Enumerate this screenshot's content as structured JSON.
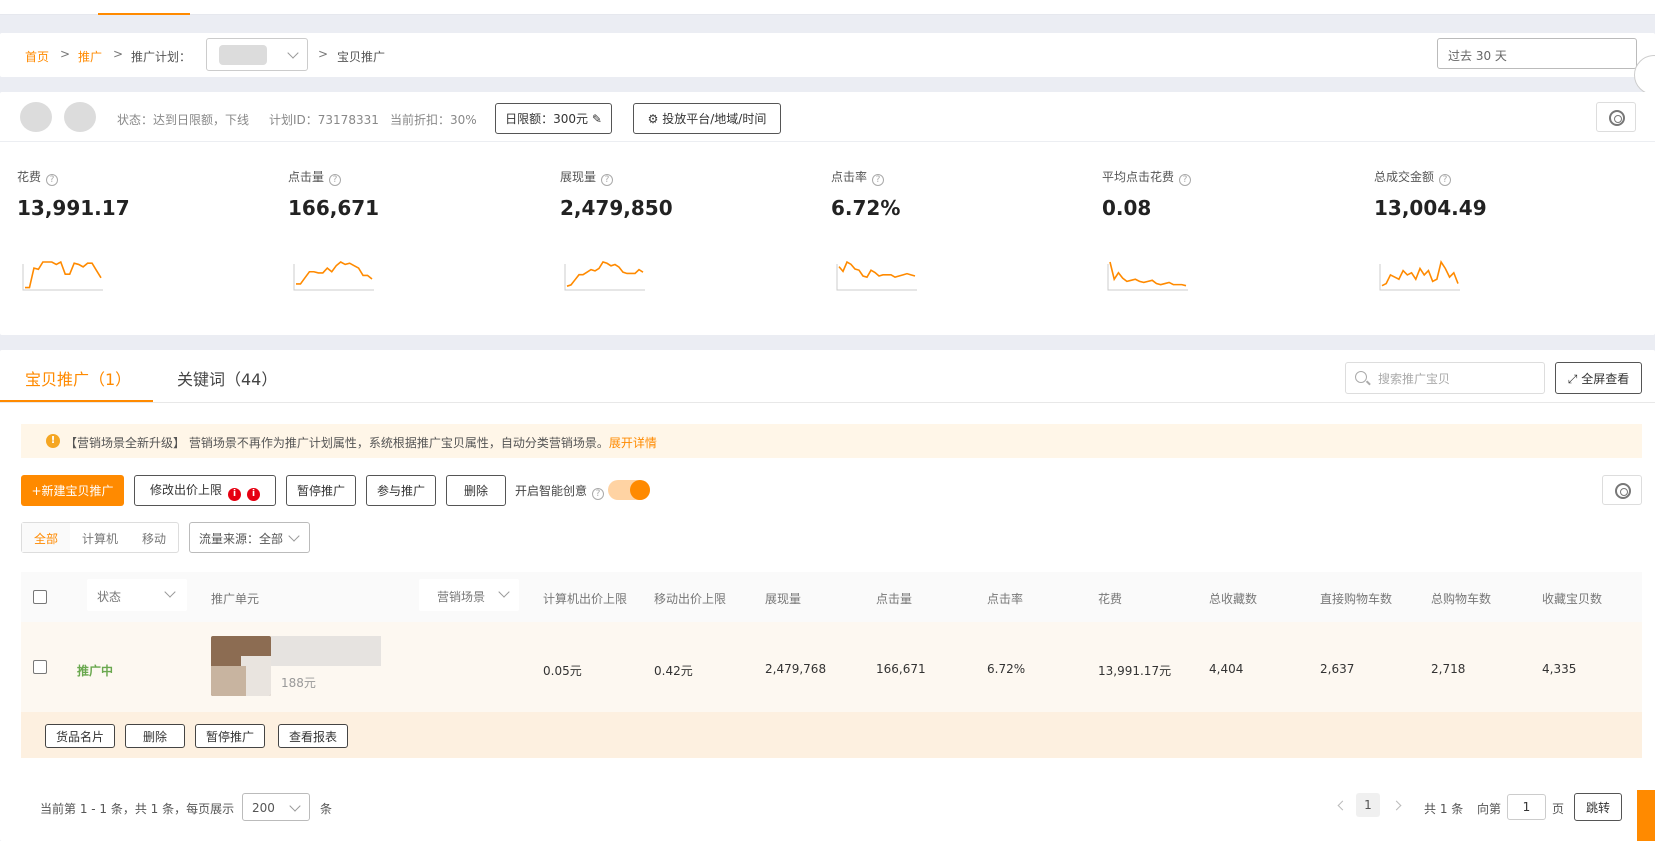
{
  "breadcrumb": {
    "home": "首页",
    "promote": "推广",
    "plan_label": "推广计划：",
    "current": "宝贝推广",
    "separator": ">"
  },
  "date_range": "过去 30 天",
  "plan": {
    "status": "状态：达到日限额，下线",
    "plan_id": "计划ID：73178331",
    "discount": "当前折扣：30%",
    "daily_limit_button": "日限额：300元",
    "platform_button": "投放平台/地域/时间"
  },
  "metrics": [
    {
      "label": "花费",
      "value": "13,991.17"
    },
    {
      "label": "点击量",
      "value": "166,671"
    },
    {
      "label": "展现量",
      "value": "2,479,850"
    },
    {
      "label": "点击率",
      "value": "6.72%"
    },
    {
      "label": "平均点击花费",
      "value": "0.08"
    },
    {
      "label": "总成交金额",
      "value": "13,004.49"
    }
  ],
  "sparklines": {
    "color": "#ff8a00",
    "series": [
      [
        2,
        2,
        18,
        17,
        23,
        23,
        23,
        21,
        23,
        13,
        13,
        22,
        21,
        19,
        22,
        22,
        16,
        10
      ],
      [
        5,
        5,
        10,
        15,
        15,
        14,
        14,
        18,
        15,
        20,
        23,
        21,
        22,
        20,
        18,
        12,
        12,
        9
      ],
      [
        3,
        4,
        8,
        12,
        12,
        14,
        16,
        15,
        17,
        22,
        21,
        19,
        20,
        18,
        14,
        13,
        13,
        13,
        16,
        14
      ],
      [
        20,
        16,
        24,
        22,
        18,
        17,
        12,
        11,
        17,
        15,
        12,
        13,
        13,
        13,
        11,
        12,
        13,
        14,
        13,
        12
      ],
      [
        26,
        10,
        16,
        11,
        8,
        9,
        10,
        8,
        7,
        8,
        9,
        6,
        5,
        6,
        7,
        5,
        5,
        5,
        4
      ],
      [
        4,
        6,
        14,
        12,
        10,
        18,
        14,
        16,
        10,
        20,
        14,
        18,
        8,
        10,
        26,
        20,
        12,
        16,
        6
      ]
    ]
  },
  "tabs": [
    {
      "label": "宝贝推广（1）"
    },
    {
      "label": "关键词（44）"
    }
  ],
  "search": {
    "placeholder": "搜索推广宝贝"
  },
  "fullscreen_button": "全屏查看",
  "notice": {
    "text": "【营销场景全新升级】 营销场景不再作为推广计划属性，系统根据推广宝贝属性，自动分类营销场景。",
    "link": "展开详情"
  },
  "toolbar": {
    "new_button": "+新建宝贝推广",
    "modify_price_button": "修改出价上限",
    "pause_button": "暂停推广",
    "join_button": "参与推广",
    "delete_button": "删除",
    "smart_creative_label": "开启智能创意",
    "smart_creative_on": true
  },
  "device_filter": {
    "options": [
      "全部",
      "计算机",
      "移动"
    ],
    "selected": "全部"
  },
  "traffic_source": "流量来源：全部",
  "table": {
    "columns": [
      "状态",
      "推广单元",
      "营销场景",
      "计算机出价上限",
      "移动出价上限",
      "展现量",
      "点击量",
      "点击率",
      "花费",
      "总收藏数",
      "直接购物车数",
      "总购物车数",
      "收藏宝贝数"
    ],
    "row": {
      "status": "推广中",
      "price": "188元",
      "pc_bid": "0.05元",
      "mobile_bid": "0.42元",
      "impressions": "2,479,768",
      "clicks": "166,671",
      "ctr": "6.72%",
      "cost": "13,991.17元",
      "favorites": "4,404",
      "direct_cart": "2,637",
      "total_cart": "2,718",
      "fav_items": "4,335"
    },
    "row_actions": [
      "货品名片",
      "删除",
      "暂停推广",
      "查看报表"
    ]
  },
  "pagination": {
    "summary": "当前第 1 - 1 条，共 1 条，每页展示",
    "page_size": "200",
    "unit": "条",
    "current_page": "1",
    "total": "共 1 条",
    "goto_label": "向第",
    "goto_value": "1",
    "page_unit": "页",
    "jump_button": "跳转"
  }
}
